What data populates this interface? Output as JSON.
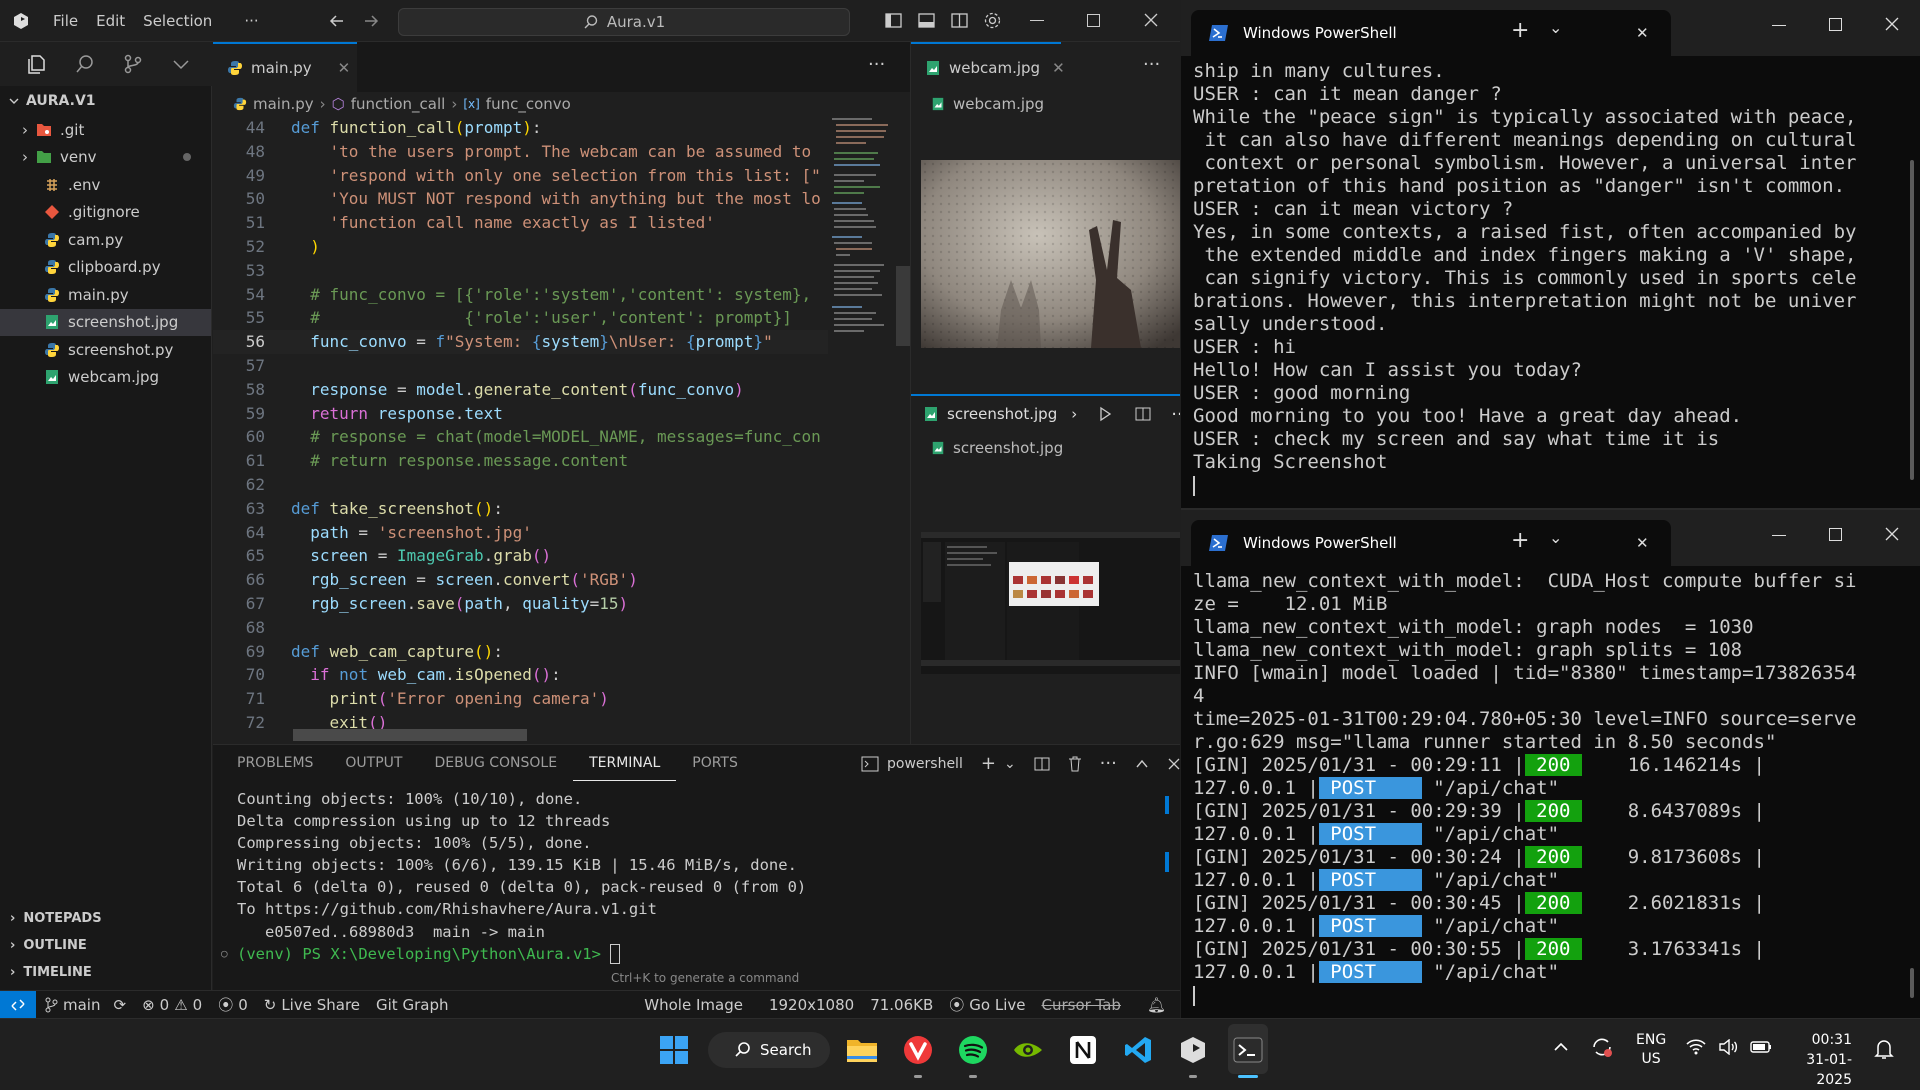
{
  "vscode": {
    "menu": [
      "File",
      "Edit",
      "Selection",
      "···"
    ],
    "search_title": "Aura.v1",
    "explorer": {
      "root": "AURA.V1",
      "items": [
        {
          "name": ".git",
          "icon": "folder-git-icon",
          "folder": true
        },
        {
          "name": "venv",
          "icon": "folder-venv-icon",
          "folder": true
        },
        {
          "name": ".env",
          "icon": "env-icon"
        },
        {
          "name": ".gitignore",
          "icon": "git-icon"
        },
        {
          "name": "cam.py",
          "icon": "python-icon"
        },
        {
          "name": "clipboard.py",
          "icon": "python-icon"
        },
        {
          "name": "main.py",
          "icon": "python-icon"
        },
        {
          "name": "screenshot.jpg",
          "icon": "image-icon",
          "selected": true
        },
        {
          "name": "screenshot.py",
          "icon": "python-icon"
        },
        {
          "name": "webcam.jpg",
          "icon": "image-icon"
        }
      ],
      "sections": [
        "NOTEPADS",
        "OUTLINE",
        "TIMELINE"
      ]
    },
    "editor_tab": "main.py",
    "breadcrumb": [
      "main.py",
      "function_call",
      "func_convo"
    ],
    "right_tabs": {
      "top_tab": "webcam.jpg",
      "top_file": "webcam.jpg",
      "bottom_tab": "screenshot.jpg",
      "bottom_file": "screenshot.jpg"
    },
    "panel_tabs": [
      "PROBLEMS",
      "OUTPUT",
      "DEBUG CONSOLE",
      "TERMINAL",
      "PORTS"
    ],
    "terminal_shell": "powershell",
    "terminal_lines": [
      "Counting objects: 100% (10/10), done.",
      "Delta compression using up to 12 threads",
      "Compressing objects: 100% (5/5), done.",
      "Writing objects: 100% (6/6), 139.15 KiB | 15.46 MiB/s, done.",
      "Total 6 (delta 0), reused 0 (delta 0), pack-reused 0 (from 0)",
      "To https://github.com/Rhishavhere/Aura.v1.git",
      "   e0507ed..68980d3  main -> main"
    ],
    "terminal_prompt": "(venv) PS X:\\Developing\\Python\\Aura.v1> ",
    "terminal_hint": "Ctrl+K to generate a command",
    "status": {
      "branch": "main",
      "errors": "0",
      "warnings": "0",
      "ports": "0",
      "live_share": "Live Share",
      "git_graph": "Git Graph",
      "whole_image": "Whole Image",
      "dims": "1920x1080",
      "size": "71.06KB",
      "go_live": "Go Live",
      "cursor_tab": "Cursor Tab"
    }
  },
  "ps1": {
    "title": "Windows PowerShell",
    "lines": [
      "ship in many cultures.",
      "USER : can it mean danger ?",
      "While the \"peace sign\" is typically associated with peace,",
      " it can also have different meanings depending on cultural",
      " context or personal symbolism. However, a universal inter",
      "pretation of this hand position as \"danger\" isn't common.",
      "USER : can it mean victory ?",
      "Yes, in some contexts, a raised fist, often accompanied by",
      " the extended middle and index fingers making a 'V' shape,",
      " can signify victory. This is commonly used in sports cele",
      "brations. However, this interpretation might not be univer",
      "sally understood.",
      "USER : hi",
      "Hello! How can I assist you today?",
      "USER : good morning",
      "Good morning to you too! Have a great day ahead.",
      "USER : check my screen and say what time it is",
      "Taking Screenshot"
    ]
  },
  "ps2": {
    "title": "Windows PowerShell",
    "lines": [
      "llama_new_context_with_model:  CUDA_Host compute buffer si",
      "ze =    12.01 MiB",
      "llama_new_context_with_model: graph nodes  = 1030",
      "llama_new_context_with_model: graph splits = 108",
      "INFO [wmain] model loaded | tid=\"8380\" timestamp=173826354",
      "4",
      "time=2025-01-31T00:29:04.780+05:30 level=INFO source=serve",
      "r.go:629 msg=\"llama runner started in 8.50 seconds\""
    ],
    "requests": [
      {
        "ts": "[GIN] 2025/01/31 - 00:29:11 |",
        "code": " 200 ",
        "dur": "    16.146214s |",
        "ip": "127.0.0.1 |",
        "method": " POST    ",
        "path": " \"/api/chat\""
      },
      {
        "ts": "[GIN] 2025/01/31 - 00:29:39 |",
        "code": " 200 ",
        "dur": "    8.6437089s |",
        "ip": "127.0.0.1 |",
        "method": " POST    ",
        "path": " \"/api/chat\""
      },
      {
        "ts": "[GIN] 2025/01/31 - 00:30:24 |",
        "code": " 200 ",
        "dur": "    9.8173608s |",
        "ip": "127.0.0.1 |",
        "method": " POST    ",
        "path": " \"/api/chat\""
      },
      {
        "ts": "[GIN] 2025/01/31 - 00:30:45 |",
        "code": " 200 ",
        "dur": "    2.6021831s |",
        "ip": "127.0.0.1 |",
        "method": " POST    ",
        "path": " \"/api/chat\""
      },
      {
        "ts": "[GIN] 2025/01/31 - 00:30:55 |",
        "code": " 200 ",
        "dur": "    3.1763341s |",
        "ip": "127.0.0.1 |",
        "method": " POST    ",
        "path": " \"/api/chat\""
      }
    ]
  },
  "taskbar": {
    "search": "Search",
    "lang": "ENG",
    "region": "US",
    "time": "00:31",
    "date": "31-01-2025"
  }
}
